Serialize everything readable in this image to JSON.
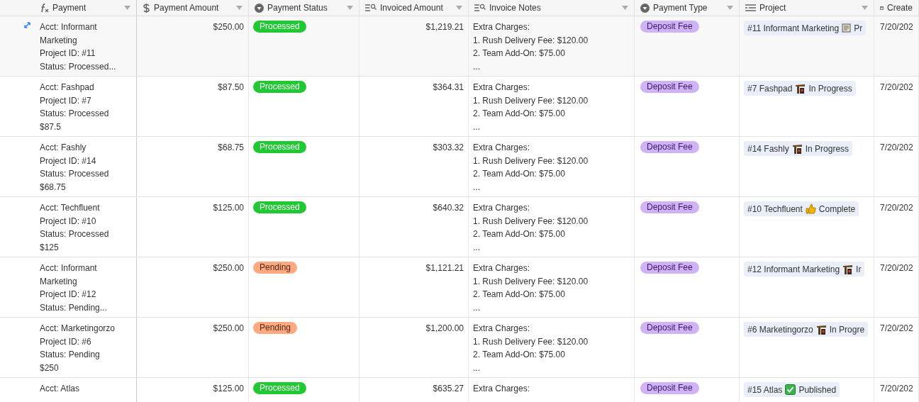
{
  "columns": [
    {
      "label": "Payment",
      "kind": "formula"
    },
    {
      "label": "Payment Amount",
      "kind": "currency"
    },
    {
      "label": "Payment Status",
      "kind": "select"
    },
    {
      "label": "Invoiced Amount",
      "kind": "lookup"
    },
    {
      "label": "Invoice Notes",
      "kind": "lookup"
    },
    {
      "label": "Payment Type",
      "kind": "select"
    },
    {
      "label": "Project",
      "kind": "link"
    },
    {
      "label": "Create",
      "kind": "date"
    }
  ],
  "rows": [
    {
      "hovered": true,
      "payment": [
        "Acct: Informant",
        "Marketing",
        "Project ID: #11",
        "Status: Processed..."
      ],
      "amount": "$250.00",
      "status": {
        "label": "Processed",
        "color": "#20c933"
      },
      "invoiced": "$1,219.21",
      "notes": [
        "Extra Charges:",
        "1. Rush Delivery Fee: $120.00",
        "2. Team Add-On: $75.00",
        "..."
      ],
      "type": "Deposit Fee",
      "project": {
        "name": "#11 Informant Marketing",
        "kind": "document",
        "state": "Pr"
      },
      "created": "7/20/202"
    },
    {
      "hovered": false,
      "payment": [
        "Acct: Fashpad",
        "Project ID: #7",
        "Status: Processed",
        "$87.5"
      ],
      "amount": "$87.50",
      "status": {
        "label": "Processed",
        "color": "#20c933"
      },
      "invoiced": "$364.31",
      "notes": [
        "Extra Charges:",
        "1. Rush Delivery Fee: $120.00",
        "2. Team Add-On: $75.00",
        "..."
      ],
      "type": "Deposit Fee",
      "project": {
        "name": "#7 Fashpad",
        "kind": "construction",
        "state": "In Progress"
      },
      "created": "7/20/202"
    },
    {
      "hovered": false,
      "payment": [
        "Acct: Fashly",
        "Project ID: #14",
        "Status: Processed",
        "$68.75"
      ],
      "amount": "$68.75",
      "status": {
        "label": "Processed",
        "color": "#20c933"
      },
      "invoiced": "$303.32",
      "notes": [
        "Extra Charges:",
        "1. Rush Delivery Fee: $120.00",
        "2. Team Add-On: $75.00",
        "..."
      ],
      "type": "Deposit Fee",
      "project": {
        "name": "#14 Fashly",
        "kind": "construction",
        "state": "In Progress"
      },
      "created": "7/20/202"
    },
    {
      "hovered": false,
      "payment": [
        "Acct: Techfluent",
        "Project ID: #10",
        "Status: Processed",
        "$125"
      ],
      "amount": "$125.00",
      "status": {
        "label": "Processed",
        "color": "#20c933"
      },
      "invoiced": "$640.32",
      "notes": [
        "Extra Charges:",
        "1. Rush Delivery Fee: $120.00",
        "2. Team Add-On: $75.00",
        "..."
      ],
      "type": "Deposit Fee",
      "project": {
        "name": "#10 Techfluent",
        "kind": "thumbs-up",
        "state": "Complete"
      },
      "created": "7/20/202"
    },
    {
      "hovered": false,
      "payment": [
        "Acct: Informant",
        "Marketing",
        "Project ID: #12",
        "Status: Pending..."
      ],
      "amount": "$250.00",
      "status": {
        "label": "Pending",
        "color": "#ffa981"
      },
      "invoiced": "$1,121.21",
      "notes": [
        "Extra Charges:",
        "1. Rush Delivery Fee: $120.00",
        "2. Team Add-On: $75.00",
        "..."
      ],
      "type": "Deposit Fee",
      "project": {
        "name": "#12 Informant Marketing",
        "kind": "construction",
        "state": "Ir"
      },
      "created": "7/20/202"
    },
    {
      "hovered": false,
      "payment": [
        "Acct: Marketingorzo",
        "Project ID: #6",
        "Status: Pending",
        "$250"
      ],
      "amount": "$250.00",
      "status": {
        "label": "Pending",
        "color": "#ffa981"
      },
      "invoiced": "$1,200.00",
      "notes": [
        "Extra Charges:",
        "1. Rush Delivery Fee: $120.00",
        "2. Team Add-On: $75.00",
        "..."
      ],
      "type": "Deposit Fee",
      "project": {
        "name": "#6 Marketingorzo",
        "kind": "construction",
        "state": "In Progre"
      },
      "created": "7/20/202"
    },
    {
      "hovered": false,
      "payment": [
        "Acct: Atlas"
      ],
      "amount": "$125.00",
      "status": {
        "label": "Processed",
        "color": "#20c933"
      },
      "invoiced": "$635.27",
      "notes": [
        "Extra Charges:"
      ],
      "type": "Deposit Fee",
      "project": {
        "name": "#15 Atlas",
        "kind": "check",
        "state": "Published"
      },
      "created": "7/20/202"
    }
  ]
}
